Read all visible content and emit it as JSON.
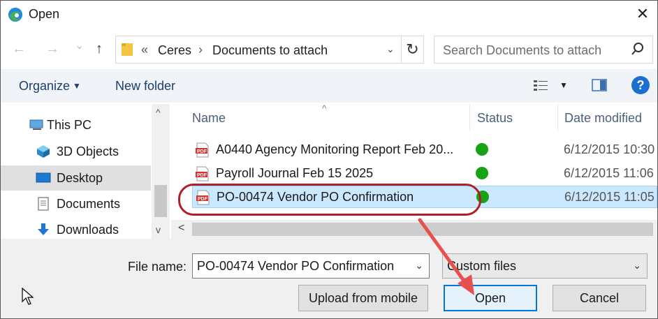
{
  "window": {
    "title": "Open",
    "close_glyph": "✕"
  },
  "nav": {
    "back_glyph": "←",
    "forward_glyph": "→",
    "recent_glyph": "⌄",
    "up_glyph": "↑",
    "path_prefix": "«",
    "path": [
      "Ceres",
      "Documents to attach"
    ],
    "path_separator": "›",
    "address_dropdown_glyph": "⌄",
    "refresh_glyph": "↻",
    "search_placeholder": "Search Documents to attach"
  },
  "toolbar": {
    "organize_label": "Organize",
    "organize_caret": "▼",
    "new_folder_label": "New folder",
    "views_caret": "▼",
    "help_glyph": "?"
  },
  "sidebar": {
    "items": [
      {
        "label": "This PC",
        "icon": "pc-icon"
      },
      {
        "label": "3D Objects",
        "icon": "cube-icon"
      },
      {
        "label": "Desktop",
        "icon": "desktop-icon",
        "selected": true
      },
      {
        "label": "Documents",
        "icon": "document-icon"
      },
      {
        "label": "Downloads",
        "icon": "download-icon"
      }
    ],
    "scroll_up_glyph": "^",
    "scroll_down_glyph": "v"
  },
  "filelist": {
    "columns": [
      "Name",
      "Status",
      "Date modified"
    ],
    "sort_glyph": "^",
    "files": [
      {
        "name": "A0440 Agency Monitoring Report Feb 20...",
        "status": "synced",
        "date": "6/12/2015 10:30"
      },
      {
        "name": "Payroll Journal Feb 15 2025",
        "status": "synced",
        "date": "6/12/2015 11:06"
      },
      {
        "name": "PO-00474 Vendor PO Confirmation",
        "status": "synced",
        "date": "6/12/2015 11:05",
        "selected": true
      }
    ],
    "hscroll_left_glyph": "<"
  },
  "footer": {
    "file_name_label": "File name:",
    "file_name_value": "PO-00474 Vendor PO Confirmation",
    "filter_value": "Custom files",
    "dropdown_glyph": "⌄",
    "upload_label": "Upload from mobile",
    "open_label": "Open",
    "cancel_label": "Cancel"
  },
  "colors": {
    "annotation": "#b01e2a",
    "arrow": "#e8504f",
    "accent": "#0078d7",
    "status_ok": "#16a316",
    "selected_row": "#cce8ff"
  }
}
